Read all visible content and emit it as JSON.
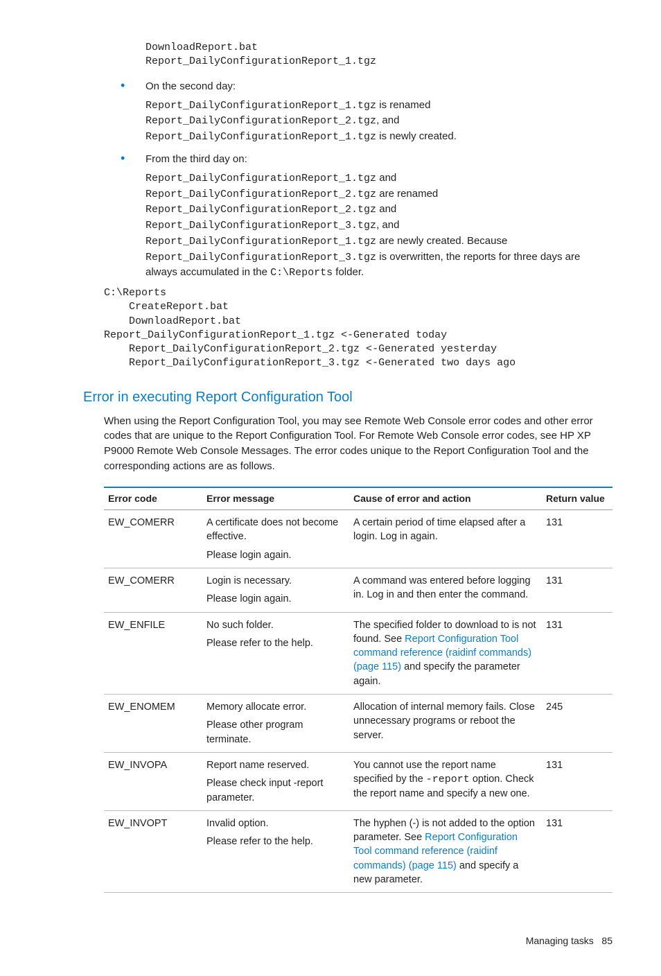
{
  "pre_top": "DownloadReport.bat\nReport_DailyConfigurationReport_1.tgz",
  "bullets": [
    {
      "lead": "On the second day:",
      "lines": [
        {
          "parts": [
            {
              "t": "mono",
              "v": "Report_DailyConfigurationReport_1.tgz"
            },
            {
              "t": "text",
              "v": " is renamed"
            }
          ]
        },
        {
          "parts": [
            {
              "t": "mono",
              "v": "Report_DailyConfigurationReport_2.tgz"
            },
            {
              "t": "text",
              "v": ", and"
            }
          ]
        },
        {
          "parts": [
            {
              "t": "mono",
              "v": "Report_DailyConfigurationReport_1.tgz"
            },
            {
              "t": "text",
              "v": " is newly created."
            }
          ]
        }
      ]
    },
    {
      "lead": "From the third day on:",
      "lines": [
        {
          "parts": [
            {
              "t": "mono",
              "v": "Report_DailyConfigurationReport_1.tgz"
            },
            {
              "t": "text",
              "v": " and"
            }
          ]
        },
        {
          "parts": [
            {
              "t": "mono",
              "v": "Report_DailyConfigurationReport_2.tgz"
            },
            {
              "t": "text",
              "v": " are renamed"
            }
          ]
        },
        {
          "parts": [
            {
              "t": "mono",
              "v": "Report_DailyConfigurationReport_2.tgz"
            },
            {
              "t": "text",
              "v": " and"
            }
          ]
        },
        {
          "parts": [
            {
              "t": "mono",
              "v": "Report_DailyConfigurationReport_3.tgz"
            },
            {
              "t": "text",
              "v": ", and"
            }
          ]
        },
        {
          "parts": [
            {
              "t": "mono",
              "v": "Report_DailyConfigurationReport_1.tgz"
            },
            {
              "t": "text",
              "v": " are newly created. Because"
            }
          ]
        },
        {
          "parts": [
            {
              "t": "mono",
              "v": "Report_DailyConfigurationReport_3.tgz"
            },
            {
              "t": "text",
              "v": " is overwritten, the reports for three days are always accumulated in the "
            },
            {
              "t": "mono",
              "v": "C:\\Reports"
            },
            {
              "t": "text",
              "v": " folder."
            }
          ]
        }
      ]
    }
  ],
  "code_flat": "C:\\Reports\n    CreateReport.bat\n    DownloadReport.bat\nReport_DailyConfigurationReport_1.tgz <-Generated today\n    Report_DailyConfigurationReport_2.tgz <-Generated yesterday\n    Report_DailyConfigurationReport_3.tgz <-Generated two days ago",
  "section_title": "Error in executing Report Configuration Tool",
  "section_body": "When using the Report Configuration Tool, you may see Remote Web Console error codes and other error codes that are unique to the Report Configuration Tool. For Remote Web Console error codes, see HP XP P9000 Remote Web Console Messages. The error codes unique to the Report Configuration Tool and the corresponding actions are as follows.",
  "table": {
    "headers": [
      "Error code",
      "Error message",
      "Cause of error and action",
      "Return value"
    ],
    "rows": [
      {
        "code": "EW_COMERR",
        "msg": [
          "A certificate does not become effective.",
          "Please login again."
        ],
        "cause": [
          {
            "t": "text",
            "v": "A certain period of time elapsed after a login. Log in again."
          }
        ],
        "ret": "131"
      },
      {
        "code": "EW_COMERR",
        "msg": [
          "Login is necessary.",
          "Please login again."
        ],
        "cause": [
          {
            "t": "text",
            "v": "A command was entered before logging in. Log in and then enter the command."
          }
        ],
        "ret": "131"
      },
      {
        "code": "EW_ENFILE",
        "msg": [
          "No such folder.",
          "Please refer to the help."
        ],
        "cause": [
          {
            "t": "text",
            "v": "The specified folder to download to is not found. See "
          },
          {
            "t": "link",
            "v": "Report Configuration Tool command reference (raidinf commands) (page 115)"
          },
          {
            "t": "text",
            "v": " and specify the parameter again."
          }
        ],
        "ret": "131"
      },
      {
        "code": "EW_ENOMEM",
        "msg": [
          "Memory allocate error.",
          "Please other program terminate."
        ],
        "cause": [
          {
            "t": "text",
            "v": "Allocation of internal memory fails. Close unnecessary programs or reboot the server."
          }
        ],
        "ret": "245"
      },
      {
        "code": "EW_INVOPA",
        "msg": [
          "Report name reserved.",
          "Please check input -report parameter."
        ],
        "cause": [
          {
            "t": "text",
            "v": "You cannot use the report name specified by the "
          },
          {
            "t": "mono",
            "v": "-report"
          },
          {
            "t": "text",
            "v": " option. Check the report name and specify a new one."
          }
        ],
        "ret": "131"
      },
      {
        "code": "EW_INVOPT",
        "msg": [
          "Invalid option.",
          "Please refer to the help."
        ],
        "cause": [
          {
            "t": "text",
            "v": "The hyphen (-) is not added to the option parameter. See "
          },
          {
            "t": "link",
            "v": "Report Configuration Tool command reference (raidinf commands) (page 115)"
          },
          {
            "t": "text",
            "v": " and specify a new parameter."
          }
        ],
        "ret": "131"
      }
    ]
  },
  "footer_section": "Managing tasks",
  "footer_page": "85"
}
